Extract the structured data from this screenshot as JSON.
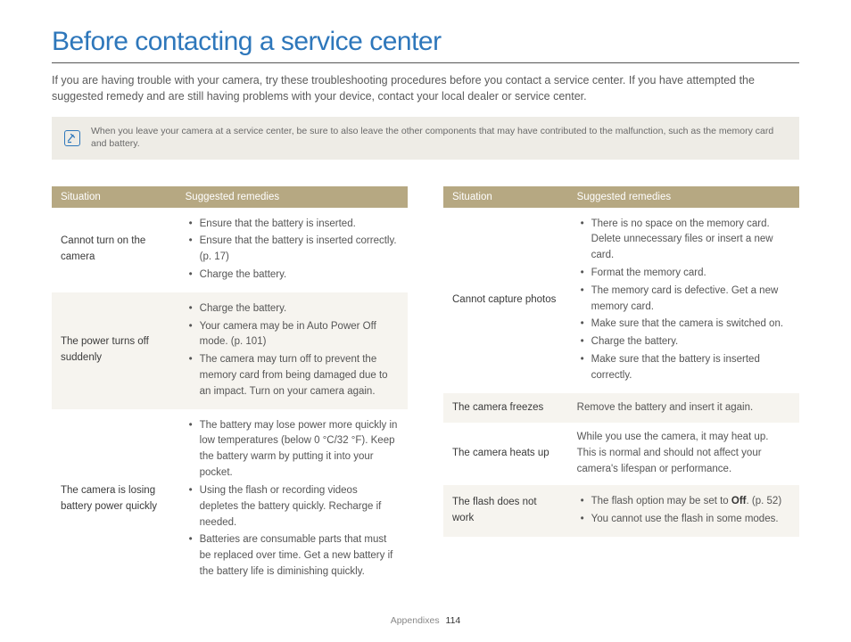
{
  "title": "Before contacting a service center",
  "intro": "If you are having trouble with your camera, try these troubleshooting procedures before you contact a service center. If you have attempted the suggested remedy and are still having problems with your device, contact your local dealer or service center.",
  "note": "When you leave your camera at a service center, be sure to also leave the other components that may have contributed to the malfunction, such as the memory card and battery.",
  "headers": {
    "situation": "Situation",
    "remedies": "Suggested remedies"
  },
  "left": [
    {
      "situation": "Cannot turn on the camera",
      "remedies": [
        "Ensure that the battery is inserted.",
        "Ensure that the battery is inserted correctly. (p. 17)",
        "Charge the battery."
      ]
    },
    {
      "situation": "The power turns off suddenly",
      "remedies": [
        "Charge the battery.",
        "Your camera may be in Auto Power Off mode. (p. 101)",
        "The camera may turn off to prevent the memory card from being damaged due to an impact. Turn on your camera again."
      ]
    },
    {
      "situation": "The camera is losing battery power quickly",
      "remedies": [
        "The battery may lose power more quickly in low temperatures (below 0 °C/32 °F). Keep the battery warm by putting it into your pocket.",
        "Using the flash or recording videos depletes the battery quickly. Recharge if needed.",
        "Batteries are consumable parts that must be replaced over time. Get a new battery if the battery life is diminishing quickly."
      ]
    }
  ],
  "right": [
    {
      "situation": "Cannot capture photos",
      "remedies": [
        "There is no space on the memory card. Delete unnecessary files or insert a new card.",
        "Format the memory card.",
        "The memory card is defective. Get a new memory card.",
        "Make sure that the camera is switched on.",
        "Charge the battery.",
        "Make sure that the battery is inserted correctly."
      ]
    },
    {
      "situation": "The camera freezes",
      "plain": "Remove the battery and insert it again."
    },
    {
      "situation": "The camera heats up",
      "plain": "While you use the camera, it may heat up. This is normal and should not affect your camera's lifespan or performance."
    },
    {
      "situation": "The flash does not work",
      "remedies_html": [
        {
          "pre": "The flash option may be set to ",
          "bold": "Off",
          "post": ". (p. 52)"
        },
        {
          "pre": "You cannot use the flash in some modes.",
          "bold": "",
          "post": ""
        }
      ]
    }
  ],
  "footer": {
    "section": "Appendixes",
    "page": "114"
  }
}
